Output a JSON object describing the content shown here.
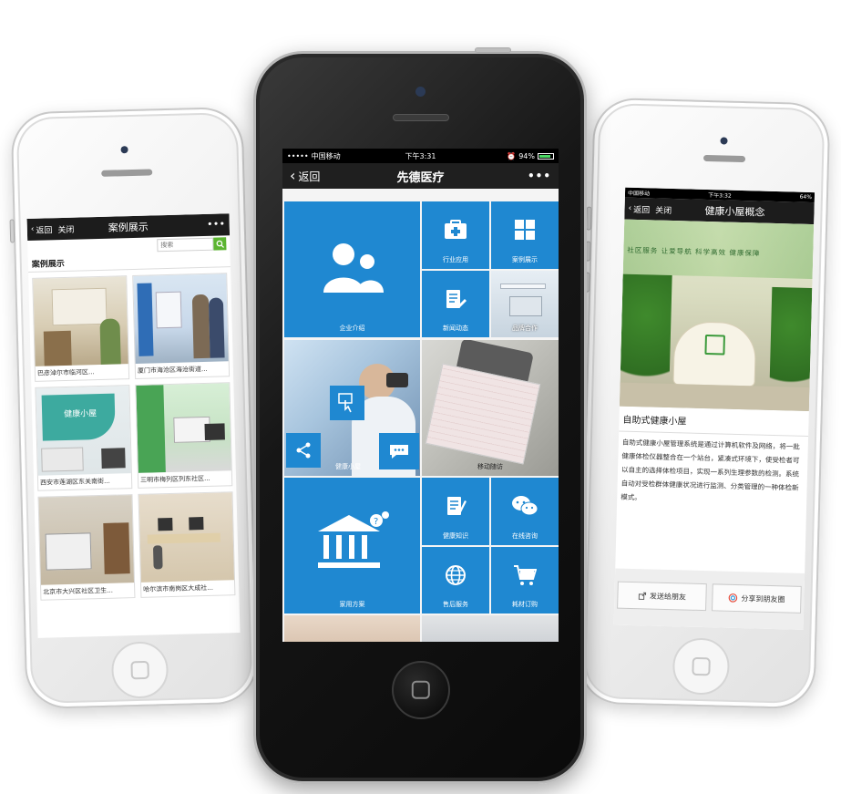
{
  "left_phone": {
    "nav": {
      "back": "返回",
      "close": "关闭",
      "title": "案例展示",
      "more": "•••"
    },
    "search": {
      "placeholder": "搜索"
    },
    "heading": "案例展示",
    "cases": [
      {
        "caption": "巴彦淖尔市临河区..."
      },
      {
        "caption": "厦门市海沧区海沧街道..."
      },
      {
        "caption": "西安市莲湖区东关南街..."
      },
      {
        "caption": "三明市梅列区列东社区..."
      },
      {
        "caption": "北京市大兴区社区卫生..."
      },
      {
        "caption": "哈尔滨市南岗区大成社..."
      }
    ]
  },
  "center_phone": {
    "status": {
      "carrier": "中国移动",
      "time": "下午3:31",
      "battery": "94%"
    },
    "nav": {
      "back": "返回",
      "title": "先德医疗",
      "more": "•••"
    },
    "tiles": {
      "company": "企业介绍",
      "industry": "行业应用",
      "cases": "案例展示",
      "news": "新闻动态",
      "brand": "品牌合作",
      "health": "健康小屋",
      "mobile": "移动随访",
      "home": "家用方案",
      "knowledge": "健康知识",
      "consult": "在线咨询",
      "service": "售后服务",
      "order": "耗材订购"
    }
  },
  "right_phone": {
    "status": {
      "carrier": "中国移动",
      "time": "下午3:32",
      "battery": "64%"
    },
    "nav": {
      "back": "返回",
      "close": "关闭",
      "title": "健康小屋概念"
    },
    "photo_banner": "社区服务 让爱导航 科学高效 健康保障",
    "title": "自助式健康小屋",
    "body": "自助式健康小屋管理系统是通过计算机软件及网络，将一批健康体检仪器整合在一个站台，紧凑式环境下，使受检者可以自主的选择体检项目，实现一系列生理参数的检测。系统自动对受检群体健康状况进行监测、分类管理的一种体检新模式。",
    "actions": {
      "send": "发送给朋友",
      "share": "分享到朋友圈"
    }
  },
  "colors": {
    "tile_blue": "#1f88d1",
    "nav_dark": "#1f1f1f",
    "search_green": "#5cb531"
  }
}
